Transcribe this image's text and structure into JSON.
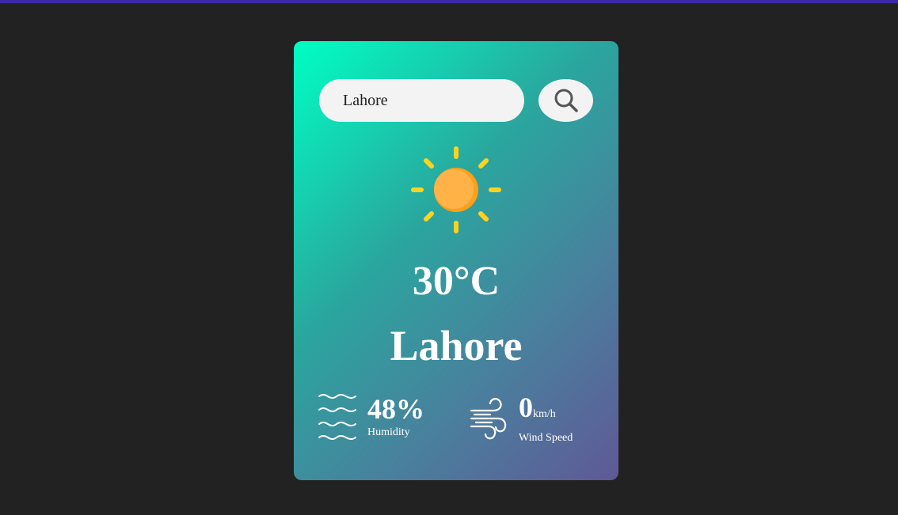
{
  "search": {
    "value": "Lahore"
  },
  "weather": {
    "condition_icon": "sun-icon",
    "temperature": "30°C",
    "city": "Lahore"
  },
  "details": {
    "humidity": {
      "value": "48%",
      "label": "Humidity",
      "icon": "humidity-icon"
    },
    "wind": {
      "value": "0",
      "unit": "km/h",
      "label": "Wind Speed",
      "icon": "wind-icon"
    }
  },
  "colors": {
    "page_background": "#222222",
    "top_accent": "#3b2aa8",
    "card_gradient_start": "#00ffc3",
    "card_gradient_end": "#5f5996",
    "search_background": "#f3f3f3",
    "sun_rays": "#ffd21f",
    "sun_body": "#ffae3a"
  }
}
